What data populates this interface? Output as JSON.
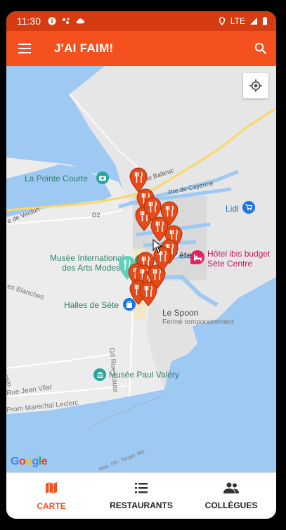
{
  "status_bar": {
    "time": "11:30",
    "network": "LTE"
  },
  "app_bar": {
    "title": "J'AI FAIM!"
  },
  "map": {
    "labels": {
      "la_pointe_courte": "La Pointe Courte",
      "rte_de_balaruc": "Rte de Balaruc",
      "rte_de_cayenne": "Rte de Cayenne",
      "rte_de_verdun": "e de Verdun",
      "d2": "D2",
      "lidl": "Lidl",
      "musee_international_1": "Musée International",
      "musee_international_2": "des Arts Modes",
      "hotel_ibis_1": "Hôtel ibis budget",
      "hotel_ibis_2": "Sète Centre",
      "sete_fragment": "ète",
      "halles_de_sete": "Halles de Sète",
      "rue_blanches": "es Blanches",
      "le_spoon": "Le Spoon",
      "ferme_temporairement": "Fermé temporairement",
      "gd_rue_haute": "Gd Rue Haute",
      "cassin": "Cassin",
      "rue_jean_vilar": "Rue Jean Vilar",
      "prom_marechal_leclerc": "Prom Maréchal Leclerc",
      "musee_paul_valery": "Musée Paul Valéry",
      "sete_fr_tanger": "Sète, FR - Tanger, MA"
    },
    "google_logo": {
      "g1": "G",
      "o1": "o",
      "o2": "o",
      "g2": "g",
      "l": "l",
      "e": "e"
    },
    "pin_color": "#e64a19",
    "pin_count": 16
  },
  "bottom_nav": {
    "items": [
      {
        "label": "CARTE",
        "icon": "map-icon",
        "active": true
      },
      {
        "label": "RESTAURANTS",
        "icon": "list-icon",
        "active": false
      },
      {
        "label": "COLLÈGUES",
        "icon": "people-icon",
        "active": false
      }
    ]
  },
  "colors": {
    "accent": "#f4511e",
    "status_bar": "#d63c12",
    "water": "#9ec9f2",
    "land": "#e8e8e8"
  }
}
